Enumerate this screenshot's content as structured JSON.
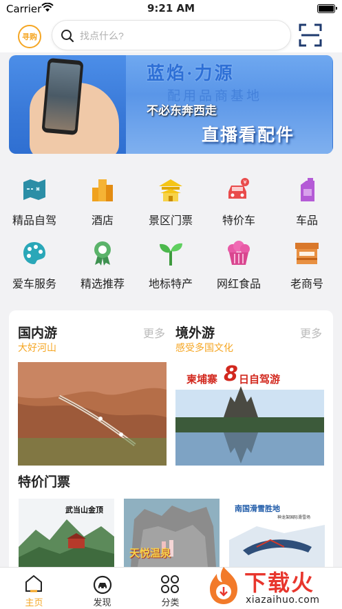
{
  "status_bar": {
    "carrier": "Carrier",
    "time": "9:21 AM"
  },
  "header": {
    "logo_text": "寻购",
    "search_placeholder": "找点什么?"
  },
  "banner": {
    "building_title": "蓝焰·力源",
    "building_sub": "配用品商基地",
    "slogan_line1": "不必东奔西走",
    "slogan_line2": "直播看配件"
  },
  "categories": [
    {
      "label": "精品自驾",
      "icon": "map-icon",
      "color": "#2b8ea6"
    },
    {
      "label": "酒店",
      "icon": "hotel-icon",
      "color": "#f0a21e"
    },
    {
      "label": "景区门票",
      "icon": "pavilion-icon",
      "color": "#f5c518"
    },
    {
      "label": "特价车",
      "icon": "car-icon",
      "color": "#e94b4b"
    },
    {
      "label": "车品",
      "icon": "bottle-icon",
      "color": "#b45bd6"
    },
    {
      "label": "爱车服务",
      "icon": "palette-icon",
      "color": "#2aa7b8"
    },
    {
      "label": "精选推荐",
      "icon": "badge-icon",
      "color": "#5bb36a"
    },
    {
      "label": "地标特产",
      "icon": "sprout-icon",
      "color": "#4cb84c"
    },
    {
      "label": "网红食品",
      "icon": "cake-icon",
      "color": "#e85aa6"
    },
    {
      "label": "老商号",
      "icon": "shop-icon",
      "color": "#d9782b"
    }
  ],
  "travel": {
    "domestic": {
      "title": "国内游",
      "subtitle": "大好河山",
      "more": "更多"
    },
    "overseas": {
      "title": "境外游",
      "subtitle": "感受多国文化",
      "more": "更多",
      "poster_left": "柬埔寨",
      "poster_num": "8",
      "poster_right": "日自驾游"
    }
  },
  "tickets": {
    "title": "特价门票",
    "items": [
      {
        "caption": "武当山金顶"
      },
      {
        "caption": "天悦温泉"
      },
      {
        "caption": "南国滑雪胜地",
        "sub": "神龙架国际滑雪场"
      }
    ]
  },
  "tabbar": [
    {
      "label": "主页",
      "active": true
    },
    {
      "label": "发现",
      "active": false
    },
    {
      "label": "分类",
      "active": false
    }
  ],
  "watermark": {
    "text": "下载火",
    "url": "xiazaihuo.com"
  }
}
